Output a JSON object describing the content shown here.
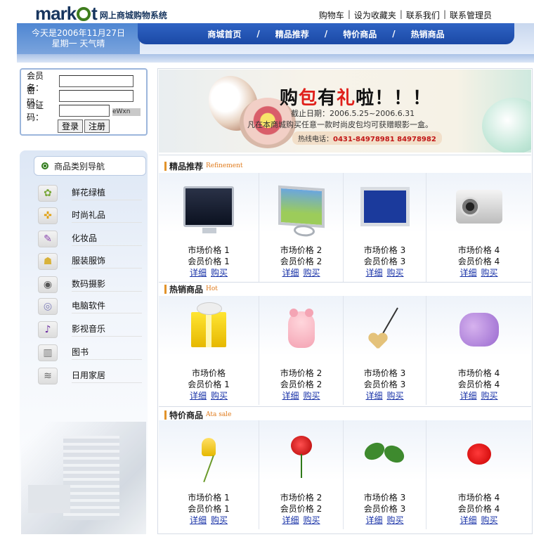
{
  "header": {
    "logo_text_left": "mark",
    "logo_text_right": "t",
    "logo_sub": "网上商城购物系统",
    "toplinks": [
      "购物车",
      "设为收藏夹",
      "联系我们",
      "联系管理员"
    ]
  },
  "banner": {
    "date_line1": "今天是2006年11月27日",
    "date_line2": "星期一  天气晴"
  },
  "nav": {
    "items": [
      "商城首页",
      "精品推荐",
      "特价商品",
      "热销商品"
    ],
    "separator": "/"
  },
  "login": {
    "user_label": "会员名：",
    "pass_label": "密　码：",
    "code_label": "验证码：",
    "captcha": "eWxn",
    "login_button": "登录",
    "register_button": "注册"
  },
  "categories": {
    "title": "商品类别导航",
    "items": [
      {
        "label": "鲜花绿植",
        "icon": "flower-icon",
        "glyph": "✿"
      },
      {
        "label": "时尚礼品",
        "icon": "gift-icon",
        "glyph": "✜"
      },
      {
        "label": "化妆品",
        "icon": "cosmetics-icon",
        "glyph": "✎"
      },
      {
        "label": "服装服饰",
        "icon": "clothing-icon",
        "glyph": "☗"
      },
      {
        "label": "数码摄影",
        "icon": "camera-icon",
        "glyph": "◉"
      },
      {
        "label": "电脑软件",
        "icon": "cd-icon",
        "glyph": "◎"
      },
      {
        "label": "影视音乐",
        "icon": "music-note-icon",
        "glyph": "♪"
      },
      {
        "label": "图书",
        "icon": "book-icon",
        "glyph": "▥"
      },
      {
        "label": "日用家居",
        "icon": "household-icon",
        "glyph": "≋"
      }
    ]
  },
  "promo": {
    "title_a": "购",
    "title_b": "包",
    "title_c": "有",
    "title_d": "礼",
    "title_e": "啦！！！",
    "date": "截止日期：2006.5.25~2006.6.31",
    "text": "凡在本商城购买任意一款时尚皮包均可获赠眼影一盒。",
    "hotline_label": "热线电话：",
    "hotline": "0431-84978981   84978982"
  },
  "sections": [
    {
      "title": "精品推荐",
      "en": "Refinement",
      "products": [
        {
          "market": "市场价格 1",
          "member": "会员价格 1",
          "detail": "详细",
          "buy": "购买",
          "pic": "crt-monitor"
        },
        {
          "market": "市场价格 2",
          "member": "会员价格 2",
          "detail": "详细",
          "buy": "购买",
          "pic": "lcd-monitor"
        },
        {
          "market": "市场价格 3",
          "member": "会员价格 3",
          "detail": "详细",
          "buy": "购买",
          "pic": "flat-monitor"
        },
        {
          "market": "市场价格  4",
          "member": "会员价格  4",
          "detail": "详细",
          "buy": "购买",
          "pic": "digital-camera"
        }
      ]
    },
    {
      "title": "热销商品",
      "en": "Hot",
      "products": [
        {
          "market": "市场价格",
          "member": "会员价格 1",
          "detail": "详细",
          "buy": "购买",
          "pic": "gift-box"
        },
        {
          "market": "市场价格 2",
          "member": "会员价格 2",
          "detail": "详细",
          "buy": "购买",
          "pic": "pink-bear"
        },
        {
          "market": "市场价格 3",
          "member": "会员价格 3",
          "detail": "详细",
          "buy": "购买",
          "pic": "heart-pendant"
        },
        {
          "market": "市场价格  4",
          "member": "会员价格  4",
          "detail": "详细",
          "buy": "购买",
          "pic": "purple-bears"
        }
      ]
    },
    {
      "title": "特价商品",
      "en": "Ata sale",
      "products": [
        {
          "market": "市场价格 1",
          "member": "会员价格 1",
          "detail": "详细",
          "buy": "购买",
          "pic": "yellow-tulip"
        },
        {
          "market": "市场价格 2",
          "member": "会员价格 2",
          "detail": "详细",
          "buy": "购买",
          "pic": "red-rose"
        },
        {
          "market": "市场价格 3",
          "member": "会员价格 3",
          "detail": "详细",
          "buy": "购买",
          "pic": "green-leaves"
        },
        {
          "market": "市场价格  4",
          "member": "会员价格  4",
          "detail": "详细",
          "buy": "购买",
          "pic": "red-rose-bloom"
        }
      ]
    }
  ]
}
